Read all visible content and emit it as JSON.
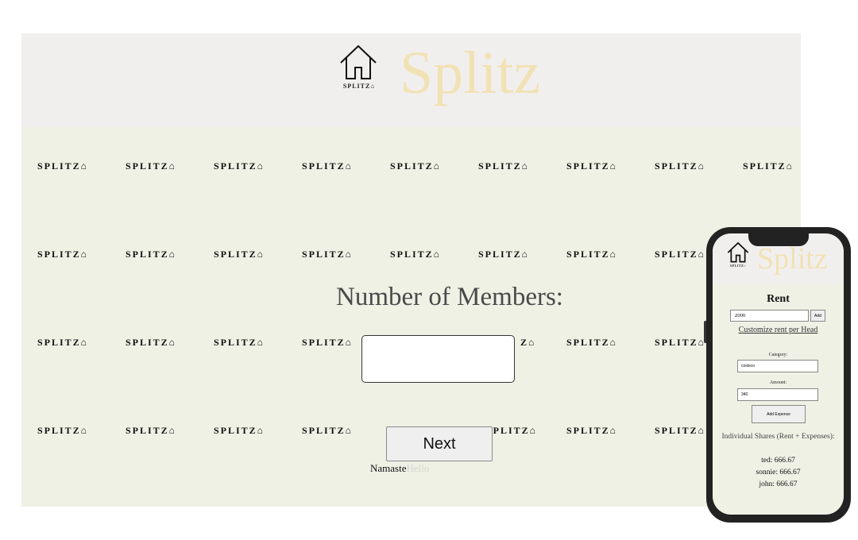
{
  "desktop": {
    "logo_text": "SPLITZ⌂",
    "title": "Splitz",
    "watermark_text": "SPLITZ⌂",
    "members_label": "Number of Members:",
    "members_value": "",
    "next_label": "Next",
    "greeting_primary": "Namaste",
    "greeting_faded": "Hello"
  },
  "mobile": {
    "logo_text": "SPLITZ⌂",
    "title": "Splitz",
    "rent_heading": "Rent",
    "rent_value": "2000",
    "add_label": "Add",
    "customize_link": "Customize rent per Head",
    "category_label": "Category:",
    "category_value": "costsco",
    "amount_label": "Amount:",
    "amount_value": "340",
    "add_expense_label": "Add Expense",
    "shares_heading": "Individual Shares (Rent + Expenses):",
    "shares": [
      "ted: 666.67",
      "sonnie: 666.67",
      "john: 666.67"
    ]
  },
  "colors": {
    "header_bg": "#f1efee",
    "body_bg": "#eff1e5",
    "title": "#f1e2b5"
  }
}
